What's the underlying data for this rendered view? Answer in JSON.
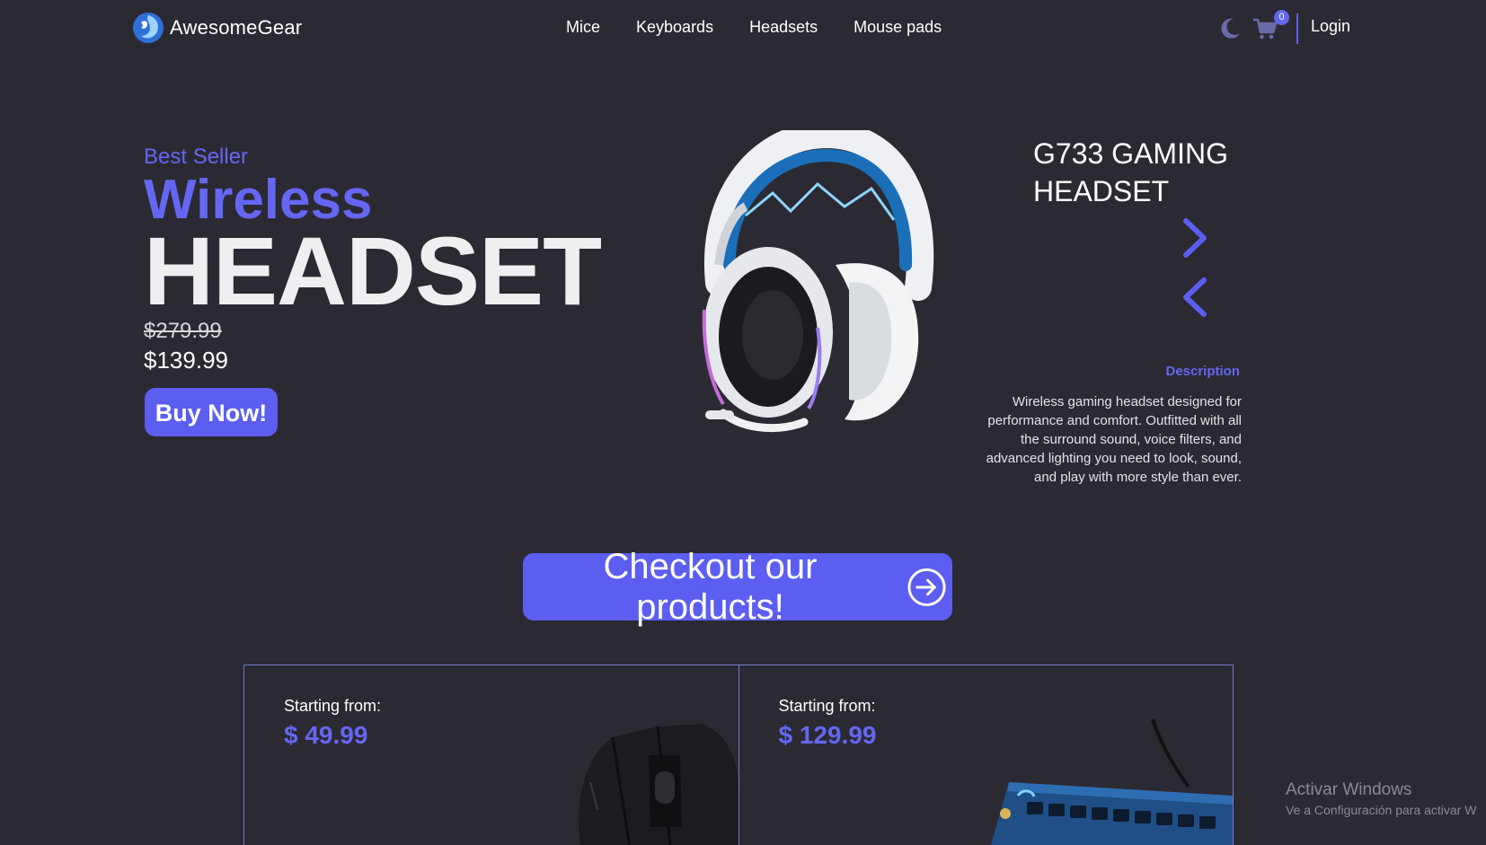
{
  "brand": {
    "name": "AwesomeGear"
  },
  "nav": {
    "links": [
      "Mice",
      "Keyboards",
      "Headsets",
      "Mouse pads"
    ],
    "cart_count": "0",
    "login": "Login"
  },
  "hero": {
    "eyebrow": "Best Seller",
    "headline_accent": "Wireless",
    "headline_main": "HEADSET",
    "old_price": "$279.99",
    "new_price": "$139.99",
    "buy_label": "Buy Now!",
    "product_title": "G733 GAMING HEADSET",
    "description_label": "Description",
    "description": "Wireless gaming headset designed for performance and comfort. Outfitted with all the surround sound, voice filters, and advanced lighting you need to look, sound, and play with more style than ever."
  },
  "cta": {
    "label": "Checkout our products!"
  },
  "cards": [
    {
      "label": "Starting from:",
      "price": "$ 49.99"
    },
    {
      "label": "Starting from:",
      "price": "$ 129.99"
    }
  ],
  "watermark": {
    "title": "Activar Windows",
    "subtitle": "Ve a Configuración para activar W"
  },
  "colors": {
    "background": "#2b2a33",
    "accent": "#5b5ef0",
    "text": "#ffffff"
  },
  "icons": [
    "brand-logo-icon",
    "moon-icon",
    "cart-icon",
    "chevron-right-icon",
    "chevron-left-icon",
    "arrow-circle-right-icon"
  ]
}
